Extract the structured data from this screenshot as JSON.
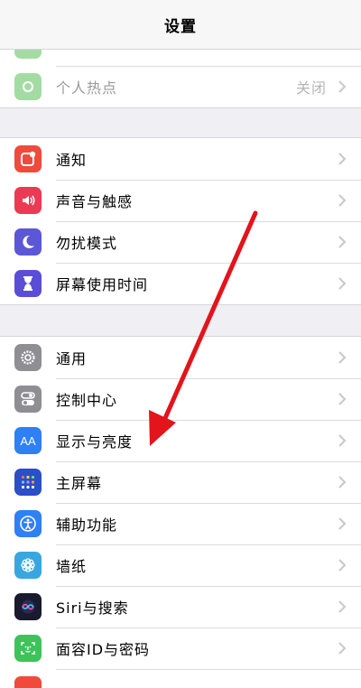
{
  "navbar": {
    "title": "设置"
  },
  "group_top": {
    "items": [
      {
        "label": "个人热点",
        "value": "关闭",
        "icon": "hotspot-icon"
      }
    ]
  },
  "group_notifications": {
    "items": [
      {
        "label": "通知",
        "icon": "notification-icon"
      },
      {
        "label": "声音与触感",
        "icon": "speaker-icon"
      },
      {
        "label": "勿扰模式",
        "icon": "moon-icon"
      },
      {
        "label": "屏幕使用时间",
        "icon": "hourglass-icon"
      }
    ]
  },
  "group_general": {
    "items": [
      {
        "label": "通用",
        "icon": "gear-icon"
      },
      {
        "label": "控制中心",
        "icon": "toggles-icon"
      },
      {
        "label": "显示与亮度",
        "icon": "aa-text-icon",
        "icon_text": "AA"
      },
      {
        "label": "主屏幕",
        "icon": "home-grid-icon"
      },
      {
        "label": "辅助功能",
        "icon": "accessibility-icon"
      },
      {
        "label": "墙纸",
        "icon": "flower-icon"
      },
      {
        "label": "Siri与搜索",
        "icon": "siri-icon"
      },
      {
        "label": "面容ID与密码",
        "icon": "face-id-icon"
      }
    ]
  },
  "colors": {
    "hotspot": "#a3dca3",
    "notification": "#ef4a3c",
    "sound": "#ec3a55",
    "dnd": "#5b57d6",
    "screen_time": "#5b4ed6",
    "general": "#8e8e93",
    "control": "#8e8e93",
    "display": "#2f7ff5",
    "home": "#2a4fc8",
    "accessibility": "#2f7ff5",
    "wallpaper": "#39a7df",
    "siri": "#1a1a2e",
    "face_id": "#3ec25a",
    "annotation_arrow": "#e3141b"
  }
}
